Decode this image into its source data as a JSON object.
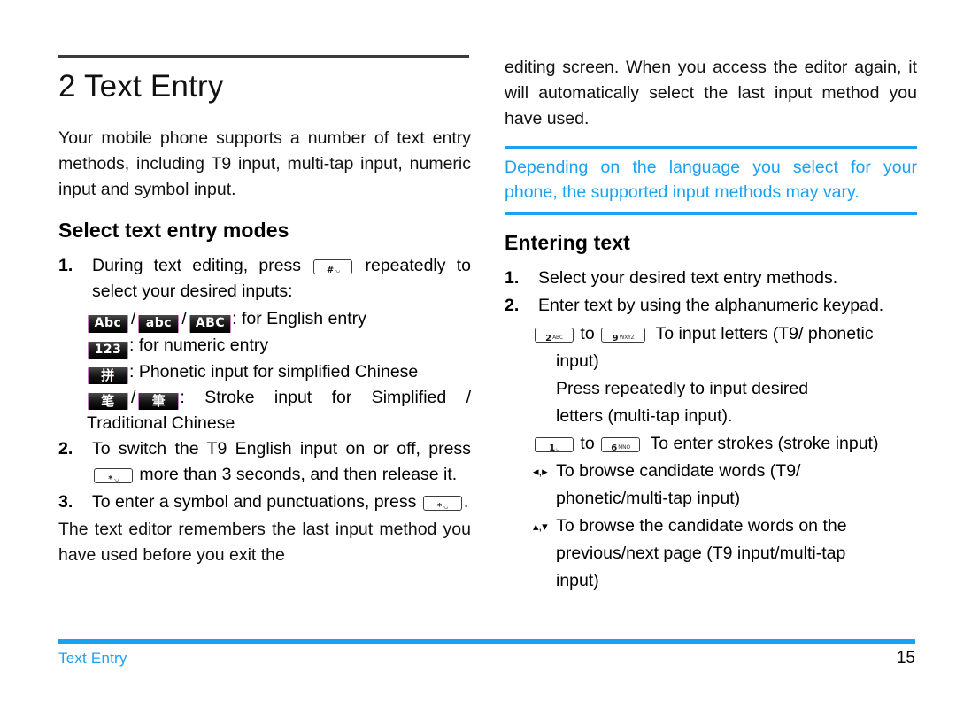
{
  "document": {
    "chapter_number_title": "2 Text Entry",
    "footer_section": "Text Entry",
    "page_number": "15",
    "accent_color": "#1ba1f2",
    "rule_color": "#3a3a3a"
  },
  "left_column": {
    "intro_paragraph": "Your mobile phone supports a number of text entry methods, including T9 input, multi-tap input, numeric input and symbol input.",
    "section_heading": "Select text entry modes",
    "steps": [
      {
        "number": "1.",
        "text_before_key": "During text editing, press",
        "key": {
          "digit": "#",
          "letters": ".␣",
          "name": "hash-key"
        },
        "text_after_key": "repeatedly to select your desired inputs:"
      },
      {
        "number": "2.",
        "text_before_key": "To switch the T9 English input on or off, press",
        "key": {
          "digit": "*",
          "letters": ".␣",
          "name": "star-key"
        },
        "text_after_key": "more than 3 seconds, and then release it."
      },
      {
        "number": "3.",
        "text_before_key": "To enter a symbol and punctuations, press",
        "key": {
          "digit": "*",
          "letters": ".␣",
          "name": "star-key"
        },
        "text_after_key": "."
      }
    ],
    "mode_badges": [
      {
        "badges": [
          "Abc",
          "abc",
          "ABC"
        ],
        "separator": "/",
        "description": ": for English entry"
      },
      {
        "badges": [
          "123"
        ],
        "separator": "/",
        "description": ": for numeric entry"
      },
      {
        "badges": [
          "拼"
        ],
        "separator": "/",
        "description": ": Phonetic input for simplified Chinese"
      },
      {
        "badges": [
          "笔",
          "筆"
        ],
        "separator": "/",
        "description": ": Stroke input for Simplified / Traditional Chinese"
      }
    ],
    "closing_paragraph": "The text editor remembers the last input method you have used before you exit the"
  },
  "right_column": {
    "continued_paragraph": "editing screen. When you access the editor again, it will automatically select the last input method you have used.",
    "note": "Depending on the language you select for your phone, the supported input methods may vary.",
    "section_heading": "Entering text",
    "steps": [
      {
        "number": "1.",
        "text": "Select your desired text entry methods."
      },
      {
        "number": "2.",
        "text": "Enter text by using the alphanumeric keypad."
      }
    ],
    "key_instructions": [
      {
        "from_key": {
          "digit": "2",
          "letters": "ABC",
          "name": "two-abc-key"
        },
        "connector": "to",
        "to_key": {
          "digit": "9",
          "letters": "WXYZ",
          "name": "nine-wxyz-key"
        },
        "text": "To input letters (T9/ phonetic",
        "text_continued": "input)",
        "extra_line_1": "Press repeatedly to input desired",
        "extra_line_2": "letters (multi-tap input)."
      },
      {
        "from_key": {
          "digit": "1",
          "letters": "␣",
          "name": "one-key"
        },
        "connector": "to",
        "to_key": {
          "digit": "6",
          "letters": "MNO",
          "name": "six-mno-key"
        },
        "text": "To enter strokes (stroke input)"
      }
    ],
    "arrow_instructions": [
      {
        "arrows": "◂,▸",
        "name": "left-right-arrow-icons",
        "line1": "To browse candidate words (T9/",
        "line2": "phonetic/multi-tap input)"
      },
      {
        "arrows": "▴,▾",
        "name": "up-down-arrow-icons",
        "line1": "To browse the candidate words on the",
        "line2": "previous/next page (T9 input/multi-tap",
        "line3": "input)"
      }
    ]
  }
}
